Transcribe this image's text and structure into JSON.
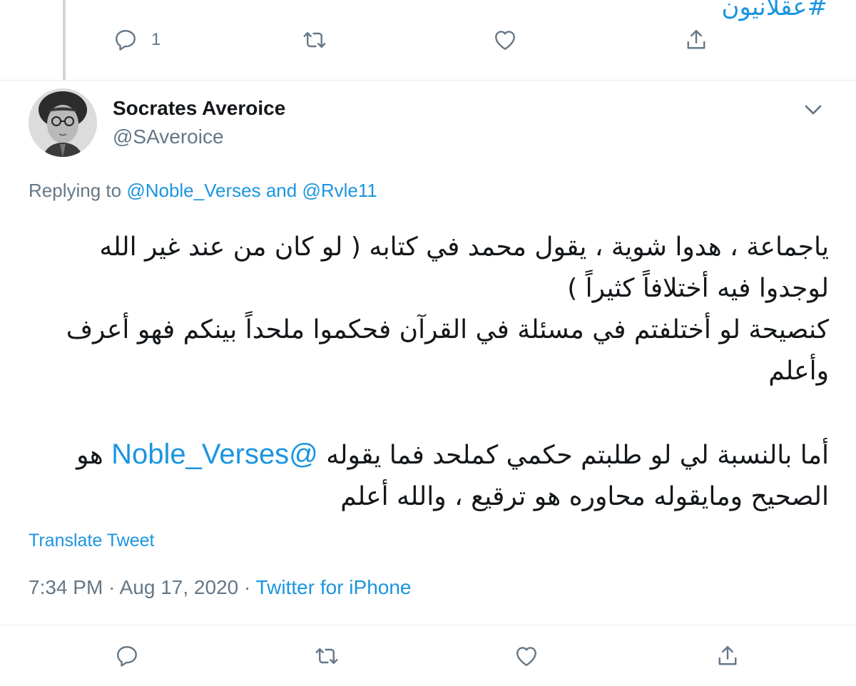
{
  "previous_tweet": {
    "hashtag": "#عقلانيون",
    "actions": {
      "reply_count": "1"
    }
  },
  "tweet": {
    "author_name": "Socrates Averoice",
    "author_handle": "@SAveroice",
    "replying": {
      "prefix": "Replying to",
      "mention_1": "@Noble_Verses",
      "connector": "and",
      "mention_2": "@Rvle11"
    },
    "body": {
      "line_1": "ياجماعة ، هدوا شوية ، يقول محمد في كتابه ( لو كان من عند غير الله",
      "line_2": "لوجدوا فيه أختلافاً كثيراً )",
      "line_3": "كنصيحة لو أختلفتم في مسئلة في القرآن فحكموا ملحداً بينكم فهو أعرف",
      "line_4": "وأعلم",
      "line_5_start": "أما بالنسبة لي لو طلبتم حكمي كملحد فما يقوله",
      "line_5_mention": "@Noble_Verses",
      "line_5_end": "هو",
      "line_6": "الصحيح ومايقوله محاوره هو ترقيع ، والله أعلم"
    },
    "translate_label": "Translate Tweet",
    "time": "7:34 PM",
    "separator": "·",
    "date": "Aug 17, 2020",
    "source": "Twitter for iPhone"
  },
  "colors": {
    "link": "#1b95e0",
    "secondary_text": "#657786",
    "primary_text": "#14171a",
    "icon": "#657786"
  }
}
